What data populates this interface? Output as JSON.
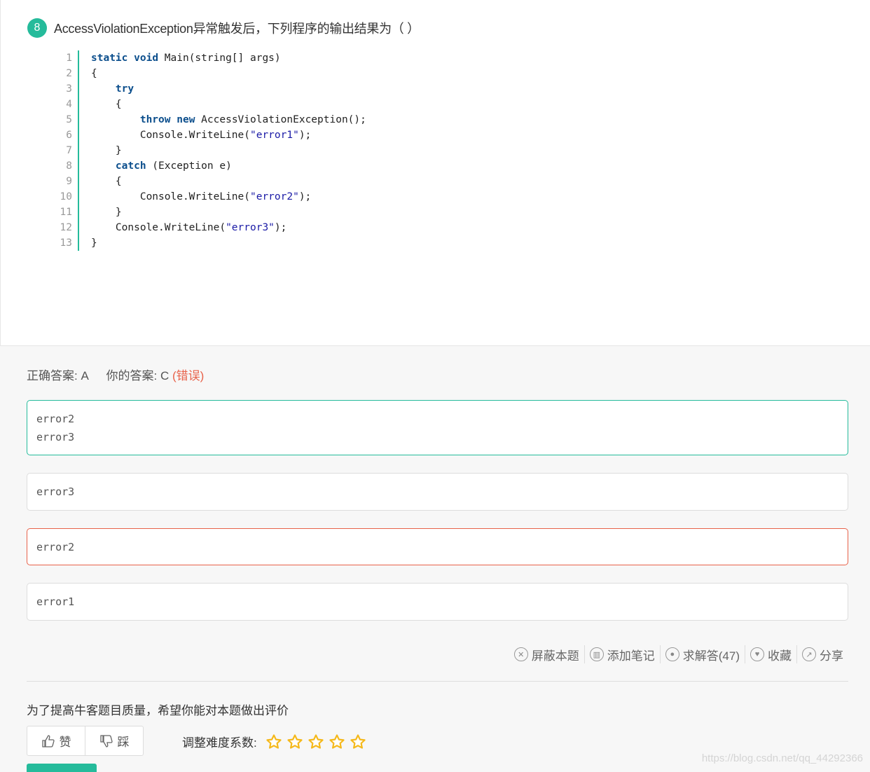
{
  "question": {
    "number": "8",
    "title": "AccessViolationException异常触发后，下列程序的输出结果为（      ）",
    "code_lines": [
      {
        "n": "1",
        "tokens": [
          {
            "t": "static",
            "c": "kw"
          },
          {
            "t": " "
          },
          {
            "t": "void",
            "c": "kw"
          },
          {
            "t": " Main(string[] args)"
          }
        ]
      },
      {
        "n": "2",
        "tokens": [
          {
            "t": "{"
          }
        ]
      },
      {
        "n": "3",
        "tokens": [
          {
            "t": "    "
          },
          {
            "t": "try",
            "c": "kw"
          }
        ]
      },
      {
        "n": "4",
        "tokens": [
          {
            "t": "    {"
          }
        ]
      },
      {
        "n": "5",
        "tokens": [
          {
            "t": "        "
          },
          {
            "t": "throw",
            "c": "kw"
          },
          {
            "t": " "
          },
          {
            "t": "new",
            "c": "kw"
          },
          {
            "t": " AccessViolationException();"
          }
        ]
      },
      {
        "n": "6",
        "tokens": [
          {
            "t": "        Console.WriteLine("
          },
          {
            "t": "\"error1\"",
            "c": "str"
          },
          {
            "t": ");"
          }
        ]
      },
      {
        "n": "7",
        "tokens": [
          {
            "t": "    }"
          }
        ]
      },
      {
        "n": "8",
        "tokens": [
          {
            "t": "    "
          },
          {
            "t": "catch",
            "c": "kw"
          },
          {
            "t": " (Exception e)"
          }
        ]
      },
      {
        "n": "9",
        "tokens": [
          {
            "t": "    {"
          }
        ]
      },
      {
        "n": "10",
        "tokens": [
          {
            "t": "        Console.WriteLine("
          },
          {
            "t": "\"error2\"",
            "c": "str"
          },
          {
            "t": ");"
          }
        ]
      },
      {
        "n": "11",
        "tokens": [
          {
            "t": "    }"
          }
        ]
      },
      {
        "n": "12",
        "tokens": [
          {
            "t": "    Console.WriteLine("
          },
          {
            "t": "\"error3\"",
            "c": "str"
          },
          {
            "t": ");"
          }
        ]
      },
      {
        "n": "13",
        "tokens": [
          {
            "t": "}"
          }
        ]
      }
    ]
  },
  "answer": {
    "correct_label": "正确答案: A",
    "yours_label": "你的答案: C",
    "verdict": "(错误)"
  },
  "options": [
    {
      "lines": [
        "error2",
        "error3"
      ],
      "state": "correct"
    },
    {
      "lines": [
        "error3"
      ],
      "state": "normal"
    },
    {
      "lines": [
        "error2"
      ],
      "state": "incorrect"
    },
    {
      "lines": [
        "error1"
      ],
      "state": "normal"
    }
  ],
  "actions": {
    "block": "屏蔽本题",
    "note": "添加笔记",
    "ask": "求解答(47)",
    "favorite": "收藏",
    "share": "分享"
  },
  "rating": {
    "prompt": "为了提高牛客题目质量，希望你能对本题做出评价",
    "like": "赞",
    "dislike": "踩",
    "difficulty_label": "调整难度系数:",
    "stars_max": 5
  },
  "watermark": "https://blog.csdn.net/qq_44292366",
  "colors": {
    "accent": "#25bb9b",
    "error": "#e8624a",
    "star": "#f5b91c"
  }
}
